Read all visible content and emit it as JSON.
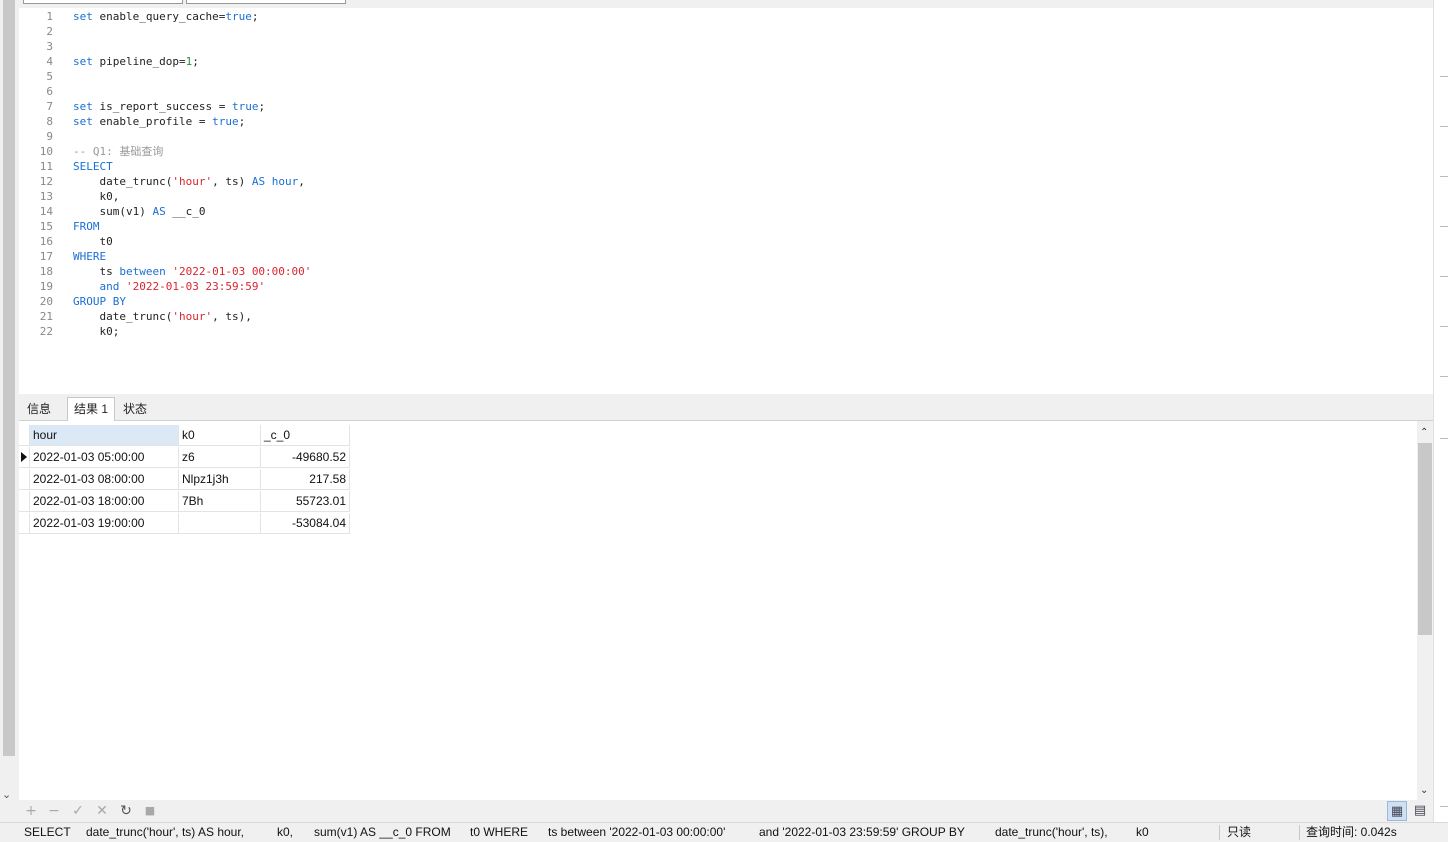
{
  "editor": {
    "lines": [
      {
        "n": "1",
        "tokens": [
          [
            "kw",
            "set"
          ],
          [
            "",
            " enable_query_cache="
          ],
          [
            "kw",
            "true"
          ],
          [
            "",
            ";"
          ]
        ]
      },
      {
        "n": "2",
        "tokens": []
      },
      {
        "n": "3",
        "tokens": []
      },
      {
        "n": "4",
        "tokens": [
          [
            "kw",
            "set"
          ],
          [
            "",
            " pipeline_dop="
          ],
          [
            "num",
            "1"
          ],
          [
            "",
            ";"
          ]
        ]
      },
      {
        "n": "5",
        "tokens": []
      },
      {
        "n": "6",
        "tokens": []
      },
      {
        "n": "7",
        "tokens": [
          [
            "kw",
            "set"
          ],
          [
            "",
            " is_report_success = "
          ],
          [
            "kw",
            "true"
          ],
          [
            "",
            ";"
          ]
        ]
      },
      {
        "n": "8",
        "tokens": [
          [
            "kw",
            "set"
          ],
          [
            "",
            " enable_profile = "
          ],
          [
            "kw",
            "true"
          ],
          [
            "",
            ";"
          ]
        ]
      },
      {
        "n": "9",
        "tokens": []
      },
      {
        "n": "10",
        "tokens": [
          [
            "cmt",
            "-- Q1: 基础查询"
          ]
        ]
      },
      {
        "n": "11",
        "tokens": [
          [
            "kw",
            "SELECT"
          ]
        ]
      },
      {
        "n": "12",
        "tokens": [
          [
            "",
            "    date_trunc("
          ],
          [
            "str",
            "'hour'"
          ],
          [
            "",
            ", ts) "
          ],
          [
            "kw",
            "AS hour"
          ],
          [
            "",
            ","
          ]
        ]
      },
      {
        "n": "13",
        "tokens": [
          [
            "",
            "    k0,"
          ]
        ]
      },
      {
        "n": "14",
        "tokens": [
          [
            "",
            "    sum(v1) "
          ],
          [
            "kw",
            "AS"
          ],
          [
            "",
            " __c_0"
          ]
        ]
      },
      {
        "n": "15",
        "tokens": [
          [
            "kw",
            "FROM"
          ]
        ]
      },
      {
        "n": "16",
        "tokens": [
          [
            "",
            "    t0"
          ]
        ]
      },
      {
        "n": "17",
        "tokens": [
          [
            "kw",
            "WHERE"
          ]
        ]
      },
      {
        "n": "18",
        "tokens": [
          [
            "",
            "    ts "
          ],
          [
            "kw",
            "between"
          ],
          [
            "",
            " "
          ],
          [
            "str",
            "'2022-01-03 00:00:00'"
          ]
        ]
      },
      {
        "n": "19",
        "tokens": [
          [
            "",
            "    "
          ],
          [
            "kw",
            "and"
          ],
          [
            "",
            " "
          ],
          [
            "str",
            "'2022-01-03 23:59:59'"
          ]
        ]
      },
      {
        "n": "20",
        "tokens": [
          [
            "kw",
            "GROUP BY"
          ]
        ]
      },
      {
        "n": "21",
        "tokens": [
          [
            "",
            "    date_trunc("
          ],
          [
            "str",
            "'hour'"
          ],
          [
            "",
            ", ts),"
          ]
        ]
      },
      {
        "n": "22",
        "tokens": [
          [
            "",
            "    k0;"
          ]
        ]
      }
    ]
  },
  "result_tabs": [
    {
      "label": "信息",
      "active": false
    },
    {
      "label": "结果 1",
      "active": true
    },
    {
      "label": "状态",
      "active": false
    }
  ],
  "grid": {
    "columns": [
      "hour",
      "k0",
      "_c_0"
    ],
    "rows": [
      [
        "2022-01-03 05:00:00",
        "z6",
        "-49680.52"
      ],
      [
        "2022-01-03 08:00:00",
        "Nlpz1j3h",
        "217.58"
      ],
      [
        "2022-01-03 18:00:00",
        "7Bh",
        "55723.01"
      ],
      [
        "2022-01-03 19:00:00",
        "",
        "-53084.04"
      ]
    ]
  },
  "toolbar": {
    "add_icon": "+",
    "remove_icon": "−",
    "apply_icon": "✓",
    "discard_icon": "✕",
    "refresh_icon": "↻",
    "stop_icon": "■",
    "grid_view_icon": "▦",
    "form_view_icon": "▤"
  },
  "status_bar": {
    "sql_parts": [
      "SELECT",
      "date_trunc('hour', ts) AS hour,",
      "k0,",
      "sum(v1) AS __c_0 FROM",
      "t0 WHERE",
      "ts between '2022-01-03 00:00:00'",
      "and '2022-01-03 23:59:59' GROUP BY",
      "date_trunc('hour', ts),",
      "k0"
    ],
    "mode": "只读",
    "query_time": "查询时间: 0.042s"
  }
}
